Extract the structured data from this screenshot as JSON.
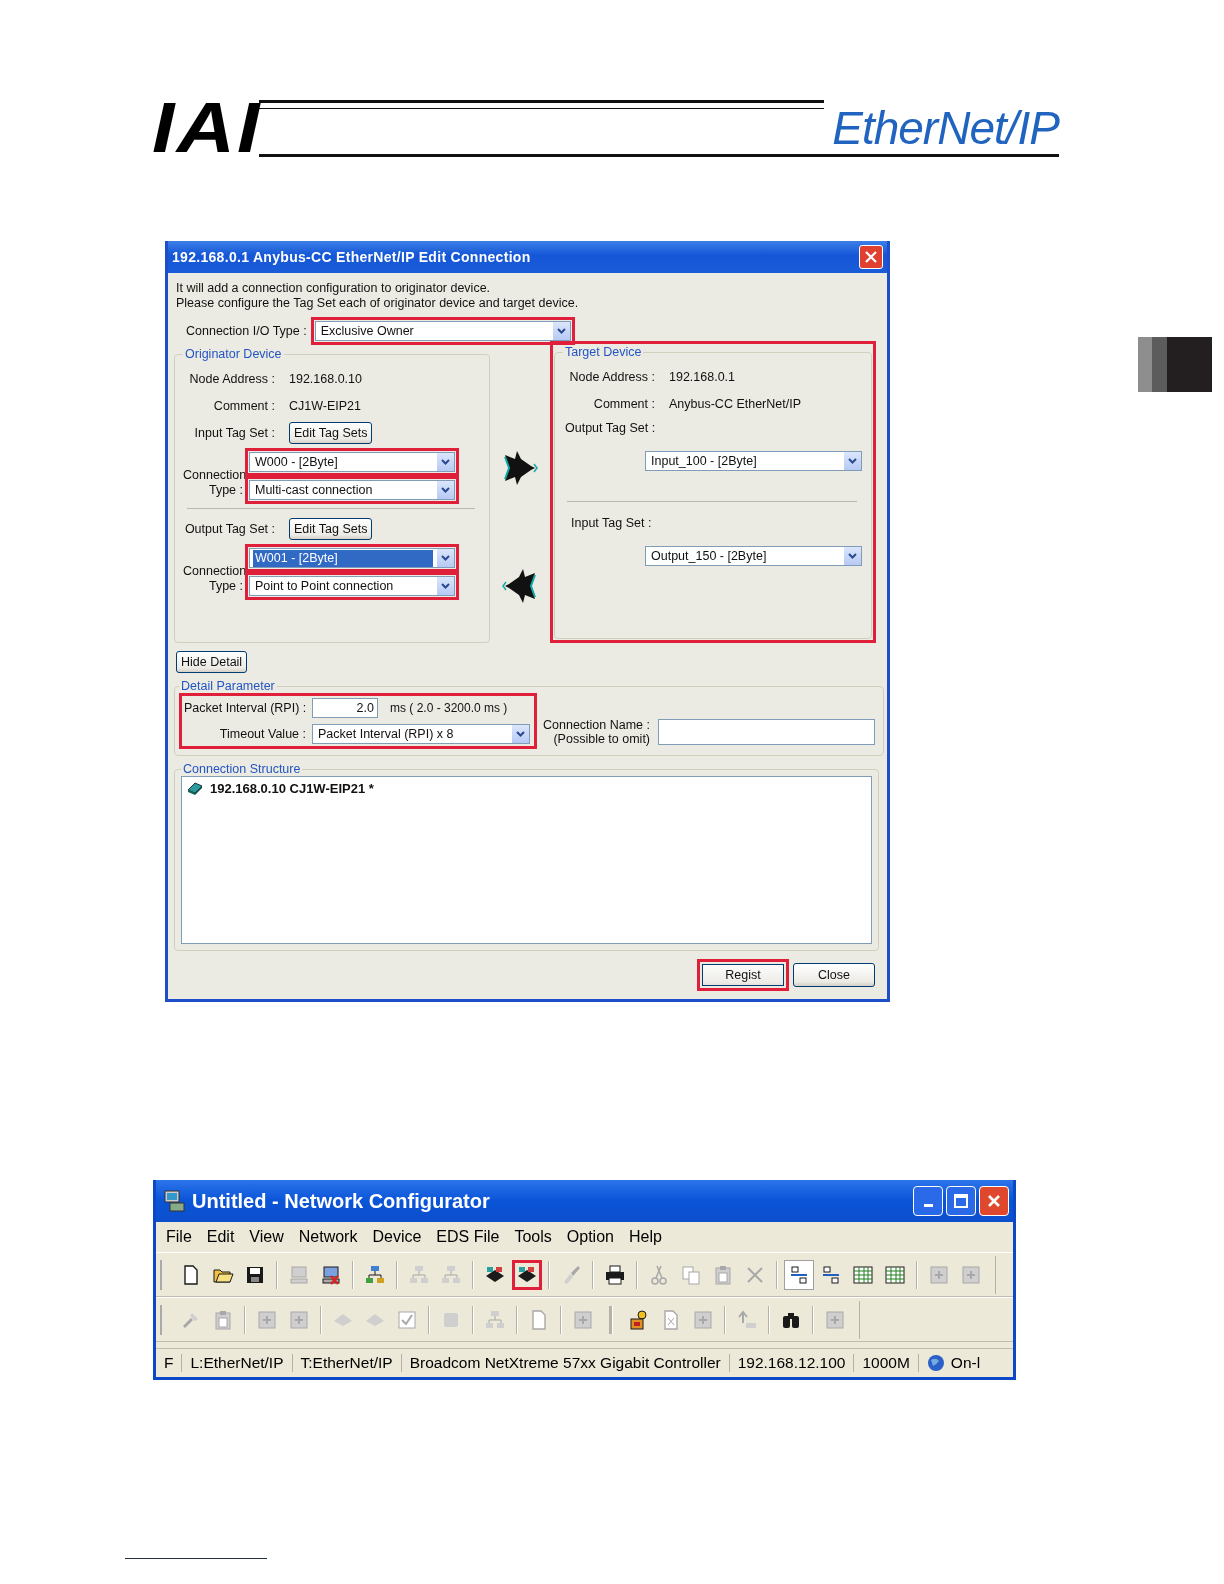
{
  "header": {
    "logo": "IAI",
    "title": "EtherNet/IP"
  },
  "dialog": {
    "title": "192.168.0.1 Anybus-CC EtherNet/IP Edit Connection",
    "intro": [
      "It will add a connection configuration to originator device.",
      "Please configure the Tag Set each of originator device and target device."
    ],
    "io_type": {
      "label": "Connection I/O Type :",
      "value": "Exclusive Owner",
      "highlighted": true
    },
    "originator": {
      "legend": "Originator Device",
      "info": [
        {
          "label": "Node Address :",
          "value": "192.168.0.10"
        },
        {
          "label": "Comment :",
          "value": "CJ1W-EIP21"
        }
      ],
      "tag_sets": [
        {
          "label": "Input Tag Set :",
          "button": "Edit Tag Sets",
          "tag": {
            "value": "W000 - [2Byte]",
            "selected": false,
            "highlighted": true
          },
          "type_label": "Connection Type :",
          "type": {
            "value": "Multi-cast connection",
            "selected": false,
            "highlighted": true
          },
          "kind": "right"
        },
        {
          "label": "Output Tag Set :",
          "button": "Edit Tag Sets",
          "tag": {
            "value": "W001 - [2Byte]",
            "selected": true,
            "highlighted": true
          },
          "type_label": "Connection Type :",
          "type": {
            "value": "Point to Point connection",
            "selected": false,
            "highlighted": true
          },
          "kind": "left"
        }
      ]
    },
    "target": {
      "legend": "Target Device",
      "highlighted": true,
      "info": [
        {
          "label": "Node Address :",
          "value": "192.168.0.1"
        },
        {
          "label": "Comment :",
          "value": "Anybus-CC EtherNet/IP"
        }
      ],
      "tag_sets": [
        {
          "label": "Output Tag Set :",
          "value": "Input_100 - [2Byte]"
        },
        {
          "label": "Input Tag Set :",
          "value": "Output_150 - [2Byte]"
        }
      ]
    },
    "hide_button": "Hide Detail",
    "detail": {
      "legend": "Detail Parameter",
      "highlighted": true,
      "rpi_label": "Packet Interval (RPI) :",
      "rpi": "2.0",
      "rpi_range": "ms ( 2.0 - 3200.0 ms )",
      "timeout_label": "Timeout Value :",
      "timeout": "Packet Interval (RPI) x 8",
      "name_label": [
        "Connection Name :",
        "(Possible to omit)"
      ]
    },
    "structure": {
      "legend": "Connection Structure",
      "items": [
        {
          "text": "192.168.0.10 CJ1W-EIP21 *"
        }
      ]
    },
    "buttons": [
      {
        "label": "Regist",
        "highlighted": true
      },
      {
        "label": "Close",
        "highlighted": false
      }
    ]
  },
  "app": {
    "title": "Untitled - Network Configurator",
    "menu": [
      "File",
      "Edit",
      "View",
      "Network",
      "Device",
      "EDS File",
      "Tools",
      "Option",
      "Help"
    ],
    "toolbars": [
      [
        [
          {
            "disabled": false,
            "pressed": false,
            "highlighted": false
          },
          {
            "disabled": false,
            "pressed": false,
            "highlighted": false
          },
          {
            "disabled": false,
            "pressed": false,
            "highlighted": false
          }
        ],
        [
          {
            "disabled": true,
            "pressed": false,
            "highlighted": false
          },
          {
            "disabled": false,
            "pressed": false,
            "highlighted": false
          }
        ],
        [
          {
            "disabled": false,
            "pressed": false,
            "highlighted": false
          }
        ],
        [
          {
            "disabled": true,
            "pressed": false,
            "highlighted": false
          },
          {
            "disabled": true,
            "pressed": false,
            "highlighted": false
          }
        ],
        [
          {
            "disabled": false,
            "pressed": false,
            "highlighted": false
          },
          {
            "disabled": false,
            "pressed": false,
            "highlighted": true
          }
        ],
        [
          {
            "disabled": true,
            "pressed": false,
            "highlighted": false
          }
        ],
        [
          {
            "disabled": false,
            "pressed": false,
            "highlighted": false
          }
        ],
        [
          {
            "disabled": true,
            "pressed": false,
            "highlighted": false
          },
          {
            "disabled": true,
            "pressed": false,
            "highlighted": false
          },
          {
            "disabled": true,
            "pressed": false,
            "highlighted": false
          },
          {
            "disabled": true,
            "pressed": false,
            "highlighted": false
          }
        ],
        [
          {
            "disabled": false,
            "pressed": true,
            "highlighted": false
          },
          {
            "disabled": false,
            "pressed": false,
            "highlighted": false
          },
          {
            "disabled": false,
            "pressed": false,
            "highlighted": false
          },
          {
            "disabled": false,
            "pressed": false,
            "highlighted": false
          }
        ],
        [
          {
            "disabled": true,
            "pressed": false,
            "highlighted": false
          },
          {
            "disabled": true,
            "pressed": false,
            "highlighted": false
          }
        ]
      ],
      [
        [
          {
            "disabled": true,
            "pressed": false,
            "highlighted": false
          },
          {
            "disabled": true,
            "pressed": false,
            "highlighted": false
          }
        ],
        [
          {
            "disabled": true,
            "pressed": false,
            "highlighted": false
          },
          {
            "disabled": true,
            "pressed": false,
            "highlighted": false
          }
        ],
        [
          {
            "disabled": true,
            "pressed": false,
            "highlighted": false
          },
          {
            "disabled": true,
            "pressed": false,
            "highlighted": false
          },
          {
            "disabled": true,
            "pressed": false,
            "highlighted": false
          }
        ],
        [
          {
            "disabled": true,
            "pressed": false,
            "highlighted": false
          }
        ],
        [
          {
            "disabled": true,
            "pressed": false,
            "highlighted": false
          }
        ],
        [
          {
            "disabled": true,
            "pressed": false,
            "highlighted": false
          }
        ],
        [
          {
            "disabled": true,
            "pressed": false,
            "highlighted": false
          }
        ],
        [
          {
            "disabled": false,
            "pressed": false,
            "highlighted": false
          },
          {
            "disabled": true,
            "pressed": false,
            "highlighted": false
          },
          {
            "disabled": true,
            "pressed": false,
            "highlighted": false
          }
        ],
        [
          {
            "disabled": true,
            "pressed": false,
            "highlighted": false
          }
        ],
        [
          {
            "disabled": false,
            "pressed": false,
            "highlighted": false
          }
        ],
        [
          {
            "disabled": true,
            "pressed": false,
            "highlighted": false
          }
        ]
      ]
    ],
    "status": [
      {
        "text": "F",
        "kind": "text"
      },
      {
        "text": "L:EtherNet/IP",
        "kind": "text"
      },
      {
        "text": "T:EtherNet/IP",
        "kind": "text"
      },
      {
        "text": "Broadcom NetXtreme 57xx Gigabit Controller",
        "kind": "text"
      },
      {
        "text": "192.168.12.100",
        "kind": "text"
      },
      {
        "text": "1000M",
        "kind": "text"
      },
      {
        "text": "On-l",
        "kind": "online"
      }
    ]
  }
}
